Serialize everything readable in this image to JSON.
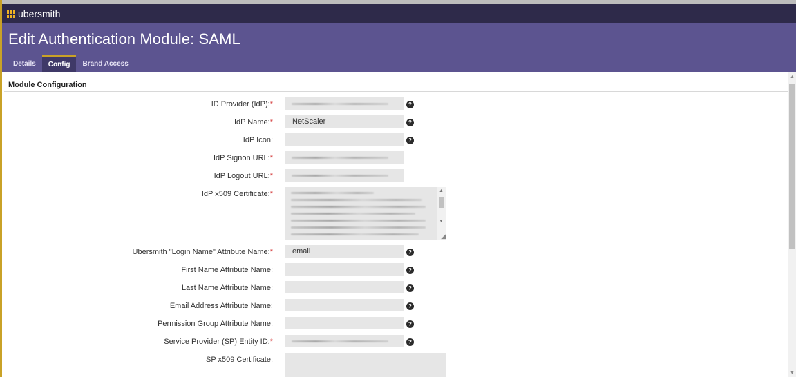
{
  "app": {
    "logo_text": "ubersmith"
  },
  "page": {
    "title": "Edit Authentication Module: SAML"
  },
  "tabs": [
    {
      "label": "Details"
    },
    {
      "label": "Config"
    },
    {
      "label": "Brand Access"
    }
  ],
  "section": {
    "title": "Module Configuration"
  },
  "required_marker": "*",
  "help_glyph": "?",
  "fields": {
    "idp": {
      "label": "ID Provider (IdP):",
      "value": ""
    },
    "idp_name": {
      "label": "IdP Name:",
      "value": "NetScaler"
    },
    "idp_icon": {
      "label": "IdP Icon:",
      "value": ""
    },
    "idp_signon_url": {
      "label": "IdP Signon URL:",
      "value": ""
    },
    "idp_logout_url": {
      "label": "IdP Logout URL:",
      "value": ""
    },
    "idp_cert": {
      "label": "IdP x509 Certificate:"
    },
    "login_name_attr": {
      "label": "Ubersmith \"Login Name\" Attribute Name:",
      "value": "email"
    },
    "first_name_attr": {
      "label": "First Name Attribute Name:",
      "value": ""
    },
    "last_name_attr": {
      "label": "Last Name Attribute Name:",
      "value": ""
    },
    "email_attr": {
      "label": "Email Address Attribute Name:",
      "value": ""
    },
    "perm_group_attr": {
      "label": "Permission Group Attribute Name:",
      "value": ""
    },
    "sp_entity_id": {
      "label": "Service Provider (SP) Entity ID:",
      "value": ""
    },
    "sp_cert": {
      "label": "SP x509 Certificate:"
    }
  },
  "colors": {
    "topbar": "#2e2a4a",
    "header": "#5c5490",
    "active_tab": "#3f3968",
    "accent": "#c9a227",
    "required": "#d43a3a",
    "input_bg": "#e6e6e6"
  },
  "icons": {
    "logo": "grid-logo-icon",
    "help": "help-circle-icon",
    "scroll_up": "scroll-up-arrow-icon",
    "scroll_down": "scroll-down-arrow-icon",
    "resize": "resize-grip-icon"
  }
}
